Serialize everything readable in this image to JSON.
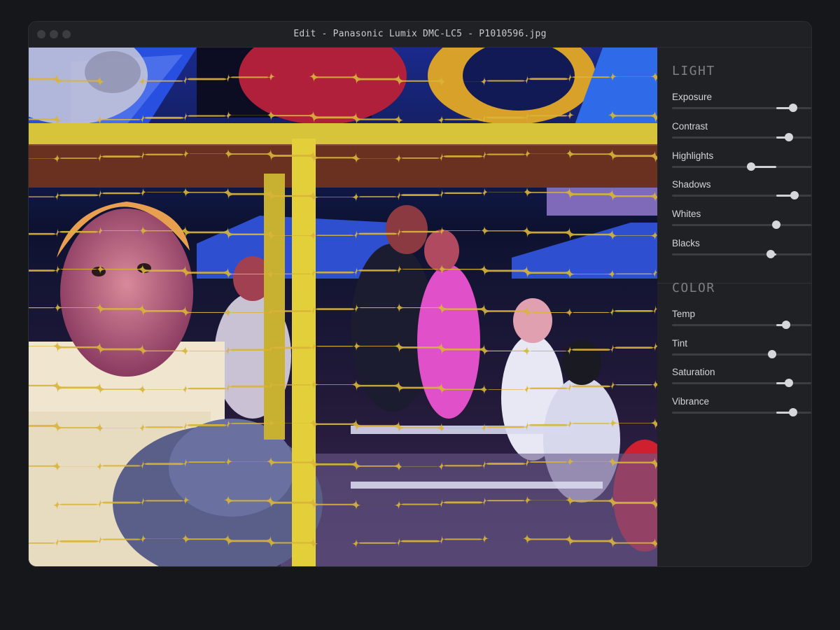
{
  "window": {
    "title": "Edit - Panasonic Lumix DMC-LC5 - P1010596.jpg"
  },
  "photo": {
    "icon": "photo-preview"
  },
  "panel": {
    "sections": [
      {
        "title": "LIGHT",
        "sliders": [
          {
            "label": "Exposure",
            "value": 0.87,
            "center": 0.75
          },
          {
            "label": "Contrast",
            "value": 0.84,
            "center": 0.75
          },
          {
            "label": "Highlights",
            "value": 0.57,
            "center": 0.75
          },
          {
            "label": "Shadows",
            "value": 0.88,
            "center": 0.75
          },
          {
            "label": "Whites",
            "value": 0.75,
            "center": 0.75
          },
          {
            "label": "Blacks",
            "value": 0.71,
            "center": 0.75
          }
        ]
      },
      {
        "title": "COLOR",
        "sliders": [
          {
            "label": "Temp",
            "value": 0.82,
            "center": 0.75
          },
          {
            "label": "Tint",
            "value": 0.72,
            "center": 0.75
          },
          {
            "label": "Saturation",
            "value": 0.84,
            "center": 0.75
          },
          {
            "label": "Vibrance",
            "value": 0.87,
            "center": 0.75
          }
        ]
      }
    ]
  }
}
